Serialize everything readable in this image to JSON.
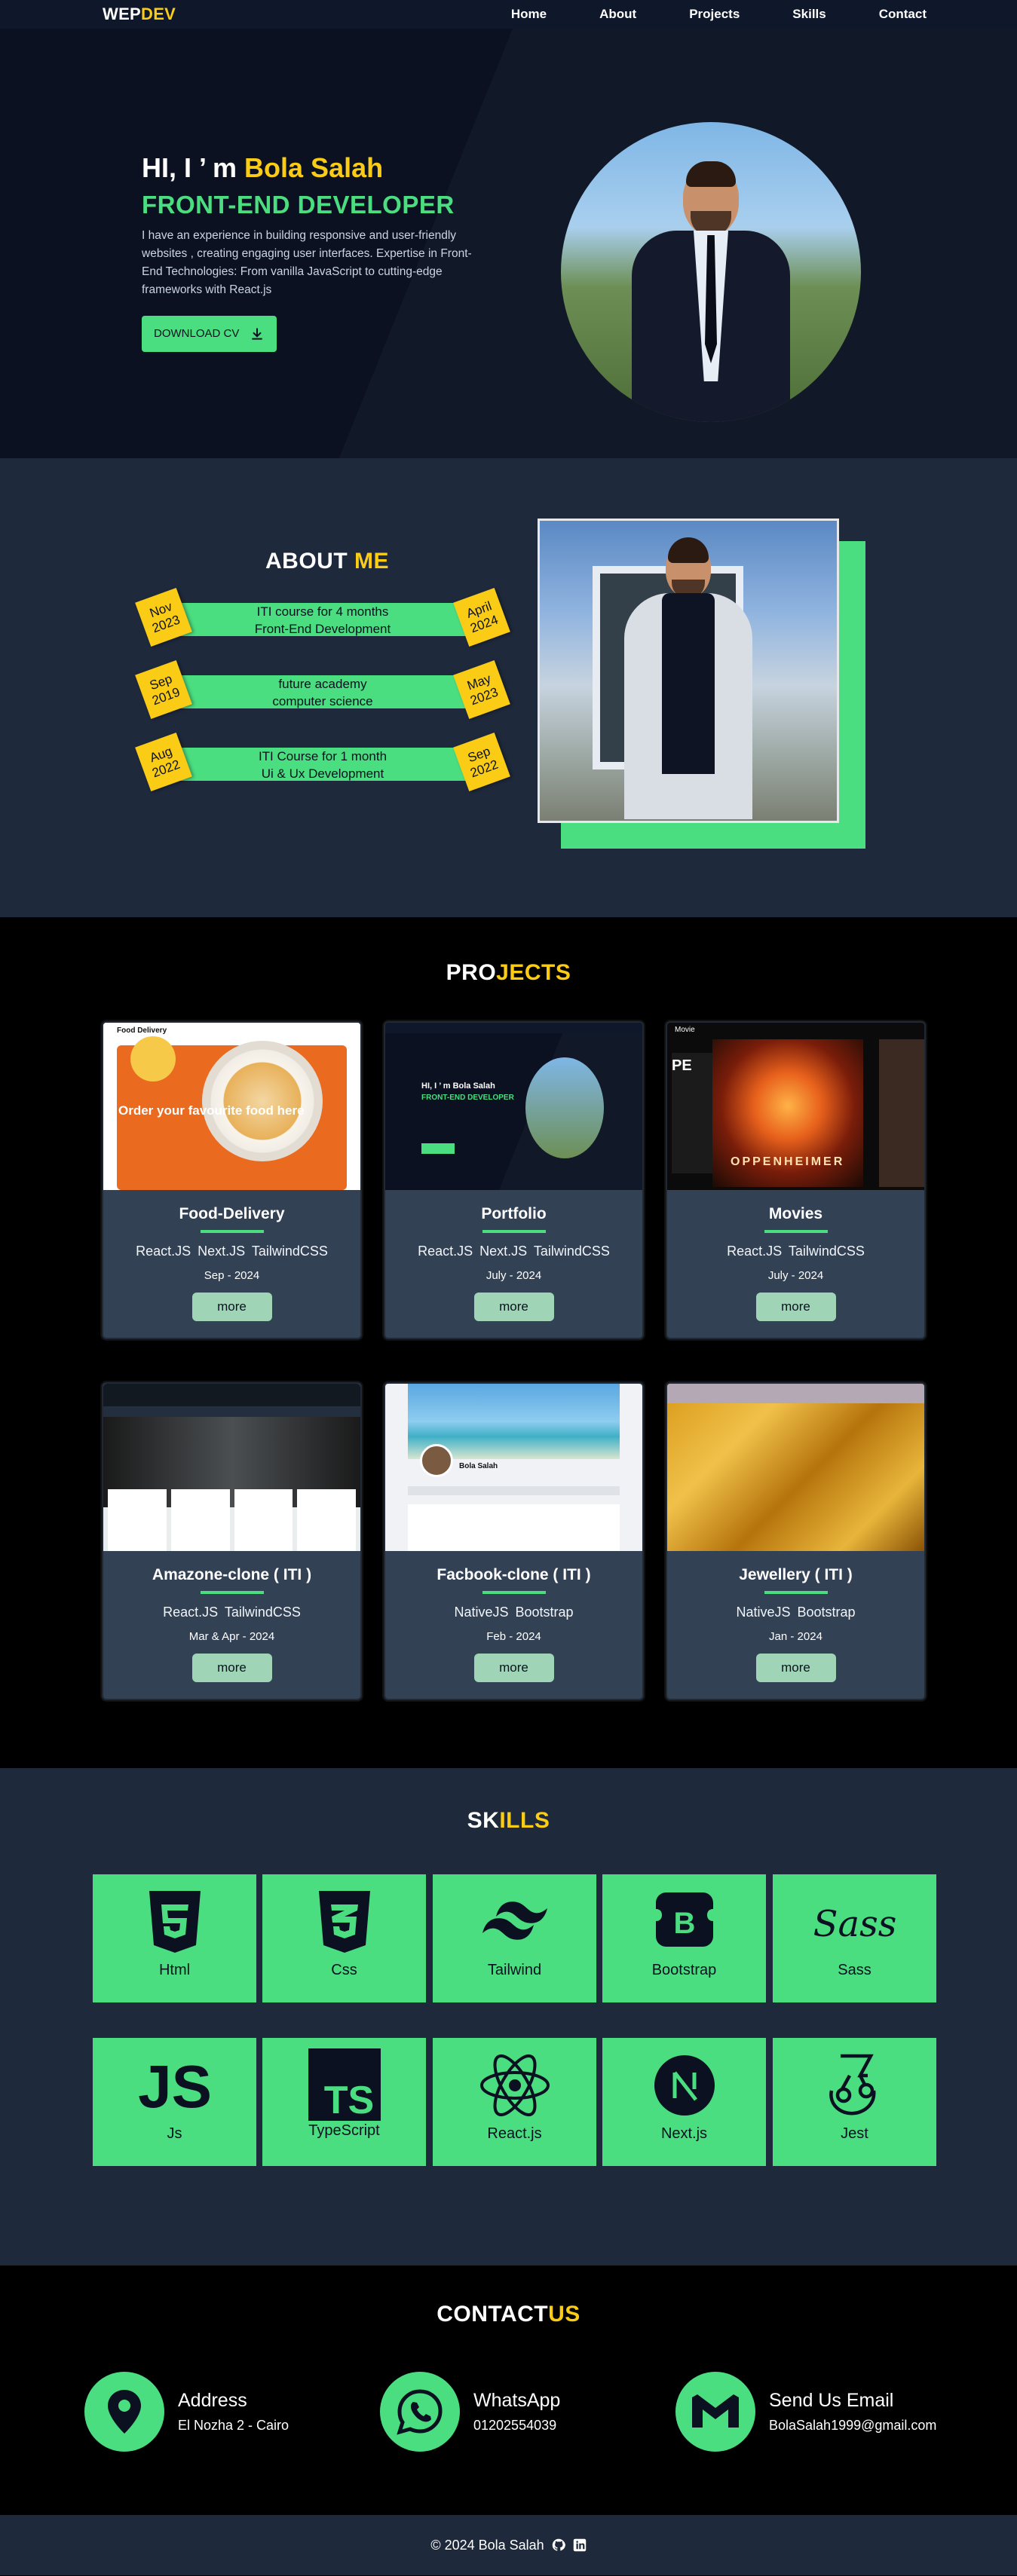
{
  "nav": {
    "logo_part1": "WEP",
    "logo_part2": "DEV",
    "links": [
      "Home",
      "About",
      "Projects",
      "Skills",
      "Contact"
    ]
  },
  "hero": {
    "greeting": "HI, I ’ m ",
    "name": "Bola Salah",
    "role": "FRONT-END DEVELOPER",
    "description": "I have an experience in building responsive and user-friendly websites , creating engaging user interfaces. Expertise in Front-End Technologies: From vanilla JavaScript to cutting-edge frameworks with React.js",
    "cv_button": "DOWNLOAD CV"
  },
  "about": {
    "title_part1": "ABOUT ",
    "title_part2": "ME",
    "timeline": [
      {
        "start_month": "Nov",
        "start_year": "2023",
        "line1": "ITI course for 4 months",
        "line2": "Front-End Development",
        "end_month": "April",
        "end_year": "2024"
      },
      {
        "start_month": "Sep",
        "start_year": "2019",
        "line1": "future academy",
        "line2": "computer science",
        "end_month": "May",
        "end_year": "2023"
      },
      {
        "start_month": "Aug",
        "start_year": "2022",
        "line1": "ITI Course for 1 month",
        "line2": "Ui & Ux Development",
        "end_month": "Sep",
        "end_year": "2022"
      }
    ]
  },
  "projects": {
    "title_part1": "PRO",
    "title_part2": "JECTS",
    "thumb_food_title": "Food Delivery",
    "thumb_food_text": "Order your favourite food here",
    "thumb_port_hi": "HI, I ’ m Bola Salah",
    "thumb_port_role": "FRONT-END DEVELOPER",
    "thumb_movie_brand": "Movie",
    "thumb_movie_pe": "PE",
    "thumb_movie_title": "OPPENHEIMER",
    "thumb_fb_name": "Bola Salah",
    "items": [
      {
        "title": "Food-Delivery",
        "tech": "React.JS  Next.JS  TailwindCSS",
        "date": "Sep - 2024",
        "button": "more"
      },
      {
        "title": "Portfolio",
        "tech": "React.JS  Next.JS  TailwindCSS",
        "date": "July - 2024",
        "button": "more"
      },
      {
        "title": "Movies",
        "tech": "React.JS  TailwindCSS",
        "date": "July - 2024",
        "button": "more"
      },
      {
        "title": "Amazone-clone ( ITI )",
        "tech": "React.JS  TailwindCSS",
        "date": "Mar & Apr - 2024",
        "button": "more"
      },
      {
        "title": "Facbook-clone ( ITI )",
        "tech": "NativeJS  Bootstrap",
        "date": "Feb - 2024",
        "button": "more"
      },
      {
        "title": "Jewellery ( ITI )",
        "tech": "NativeJS  Bootstrap",
        "date": "Jan - 2024",
        "button": "more"
      }
    ]
  },
  "skills": {
    "title_part1": "SK",
    "title_part2": "ILLS",
    "items": [
      {
        "label": "Html",
        "icon": "html5-icon"
      },
      {
        "label": "Css",
        "icon": "css3-icon"
      },
      {
        "label": "Tailwind",
        "icon": "tailwind-icon"
      },
      {
        "label": "Bootstrap",
        "icon": "bootstrap-icon"
      },
      {
        "label": "Sass",
        "icon": "sass-icon"
      },
      {
        "label": "Js",
        "icon": "javascript-icon"
      },
      {
        "label": "TypeScript",
        "icon": "typescript-icon"
      },
      {
        "label": "React.js",
        "icon": "react-icon"
      },
      {
        "label": "Next.js",
        "icon": "nextjs-icon"
      },
      {
        "label": "Jest",
        "icon": "jest-icon"
      }
    ]
  },
  "contact": {
    "title_part1": "CONTACT",
    "title_part2": "US",
    "items": [
      {
        "label": "Address",
        "value": "El Nozha 2 - Cairo",
        "icon": "location-pin-icon"
      },
      {
        "label": "WhatsApp",
        "value": "01202554039",
        "icon": "whatsapp-icon"
      },
      {
        "label": "Send Us Email",
        "value": "BolaSalah1999@gmail.com",
        "icon": "gmail-icon"
      }
    ]
  },
  "footer": {
    "copyright": "© 2024 Bola Salah"
  },
  "colors": {
    "accent_yellow": "#facc15",
    "accent_green": "#4ade80",
    "navy": "#1e293b"
  }
}
